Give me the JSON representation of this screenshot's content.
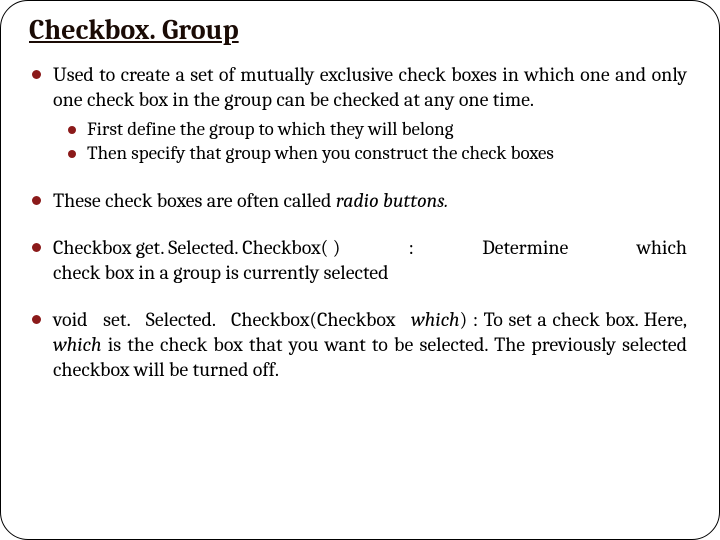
{
  "title": "Checkbox. Group",
  "bullets": {
    "b1_main": "Used to create a set of mutually exclusive check boxes in which one and only one check box in the group can be checked at any one time.",
    "b1_sub1": "First define the group to which they will belong",
    "b1_sub2": "Then specify that group when you construct the check boxes",
    "b2_prefix": "These check boxes are often called ",
    "b2_italic": "radio buttons.",
    "b3_sig": "Checkbox get. Selected. Checkbox( )",
    "b3_colon": ":",
    "b3_det": "Determine",
    "b3_which": "which",
    "b3_rest": "check box in a group is currently selected",
    "b4_sig": "void set. Selected. Checkbox(Checkbox ",
    "b4_sig_italic": "which",
    "b4_sig_close": ")",
    "b4_after1": " : To set a check box. Here, ",
    "b4_which2": "which",
    "b4_after2": " is the check box that you want to be selected. The previously selected checkbox will be turned off."
  }
}
